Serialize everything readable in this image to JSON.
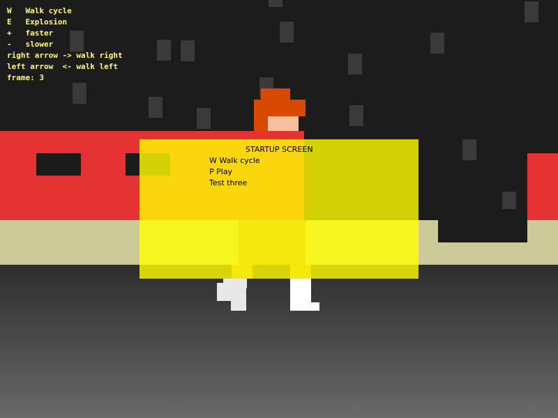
{
  "hud": {
    "lines": [
      "W   Walk cycle",
      "E   Explosion",
      "+   faster",
      "-   slower",
      "right arrow -> walk right",
      "left arrow  <- walk left"
    ],
    "frame_label": "frame:",
    "frame_value": "3"
  },
  "startup": {
    "title": "STARTUP SCREEN",
    "items": [
      "W Walk cycle",
      "P Play",
      "Test three"
    ]
  },
  "colors": {
    "hud_text": "#ffff66",
    "overlay": "#ffff00",
    "wall": "#e53333",
    "sidewalk": "#cdca9a",
    "hair": "#d94a00",
    "skin": "#f5c09a",
    "shoes": "#e8e8e8"
  },
  "icons": {
    "character": "walking-pixel-character-sprite"
  }
}
